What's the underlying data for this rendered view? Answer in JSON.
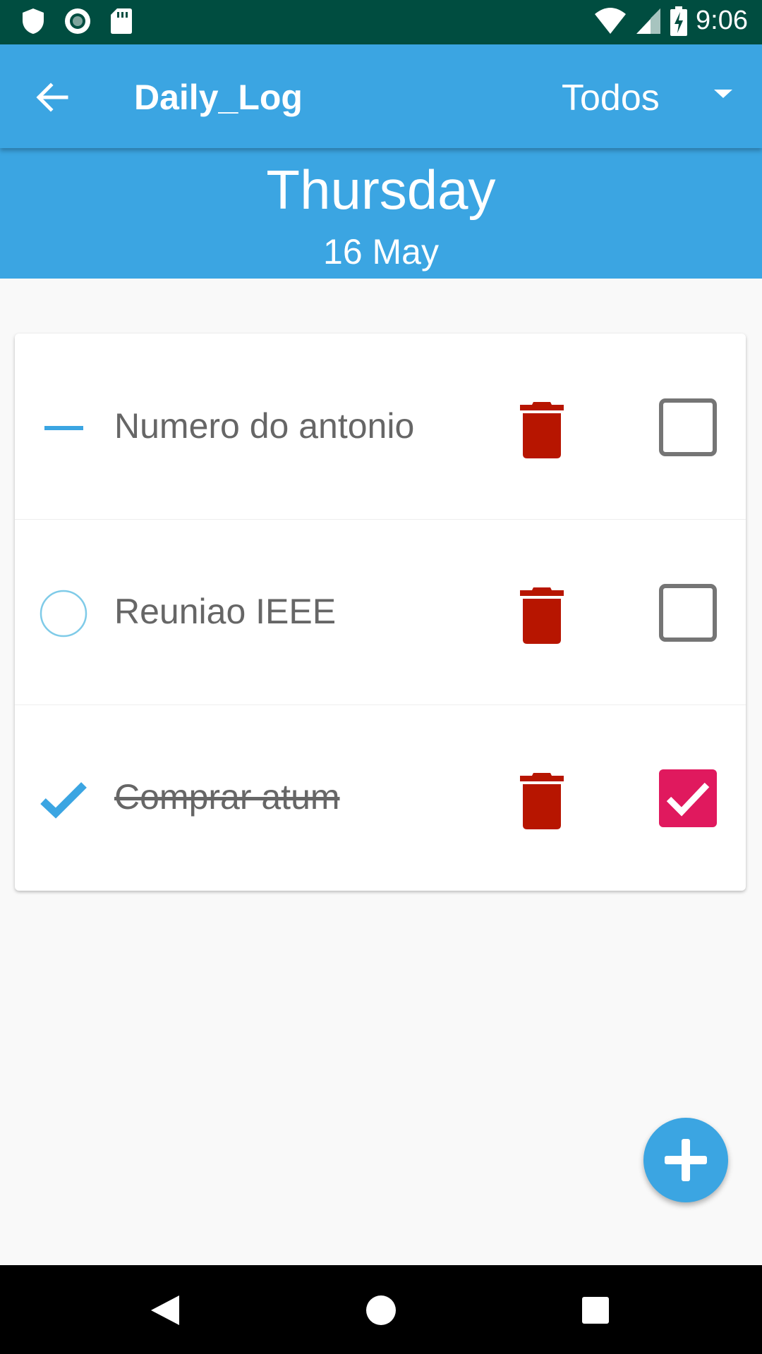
{
  "status_bar": {
    "time": "9:06",
    "icons": [
      "shield-icon",
      "circle-dot-icon",
      "sd-card-icon",
      "wifi-icon",
      "signal-icon",
      "battery-charging-icon"
    ],
    "background": "#004d40"
  },
  "app_bar": {
    "title": "Daily_Log",
    "filter_value": "Todos",
    "background": "#3ba5e2"
  },
  "date_header": {
    "day_name": "Thursday",
    "date": "16 May"
  },
  "tasks": [
    {
      "text": "Numero do antonio",
      "bullet": "dash-icon",
      "done": false
    },
    {
      "text": "Reuniao IEEE",
      "bullet": "circle-outline-icon",
      "done": false
    },
    {
      "text": "Comprar atum",
      "bullet": "check-icon",
      "done": true
    }
  ],
  "colors": {
    "accent": "#3ba5e2",
    "delete": "#b71500",
    "checked": "#e0195e",
    "text": "#666666"
  },
  "fab": {
    "icon": "plus-icon"
  },
  "nav": {
    "icons": [
      "back-triangle-icon",
      "home-circle-icon",
      "recents-square-icon"
    ]
  }
}
